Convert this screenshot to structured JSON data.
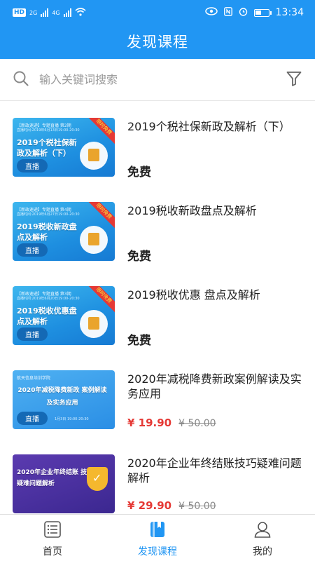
{
  "status_bar": {
    "left_badge": "HD",
    "net1": "2G",
    "net2": "4G",
    "time": "13:34"
  },
  "header": {
    "title": "发现课程"
  },
  "search": {
    "placeholder": "输入关键词搜索"
  },
  "icons": {
    "search": "search-icon",
    "filter": "filter-icon",
    "home": "list-icon",
    "discover": "bookmark-book-icon",
    "me": "user-icon"
  },
  "colors": {
    "primary": "#2196f3",
    "price": "#e53935"
  },
  "courses": [
    {
      "title": "2019个税社保新政及解析（下）",
      "price": "免费",
      "thumb_tag": "【新政速递】专题直播 第2期",
      "thumb_date": "直播时间:2019年6月13日19:00-20:30",
      "thumb_title": "2019个税社保新政及解析（下）",
      "thumb_live": "直播",
      "thumb_ribbon": "限时免费"
    },
    {
      "title": "2019税收新政盘点及解析",
      "price": "免费",
      "thumb_tag": "【新政速递】专题直播 第4期",
      "thumb_date": "直播时间:2019年6月27日19:00-20:30",
      "thumb_title": "2019税收新政盘点及解析",
      "thumb_live": "直播",
      "thumb_ribbon": "限时免费"
    },
    {
      "title": "2019税收优惠 盘点及解析",
      "price": "免费",
      "thumb_tag": "【新政速递】专题直播 第3期",
      "thumb_date": "直播时间:2019年6月20日19:00-20:30",
      "thumb_title": "2019税收优惠盘点及解析",
      "thumb_live": "直播",
      "thumb_ribbon": "限时免费"
    },
    {
      "title": "2020年减税降费新政案例解读及实务应用",
      "price": "¥ 19.90",
      "original_price": "¥ 50.00",
      "thumb_tag": "航天信息培训学院",
      "thumb_title": "2020年减税降费新政 案例解读及实务应用",
      "thumb_live": "直播",
      "thumb_date": "1月3日 19:00-20:30"
    },
    {
      "title": "2020年企业年终结账技巧疑难问题解析",
      "price": "¥ 29.90",
      "original_price": "¥ 50.00",
      "thumb_title": "2020年企业年终结账 技巧疑难问题解析"
    }
  ],
  "tabs": [
    {
      "label": "首页",
      "active": false
    },
    {
      "label": "发现课程",
      "active": true
    },
    {
      "label": "我的",
      "active": false
    }
  ]
}
